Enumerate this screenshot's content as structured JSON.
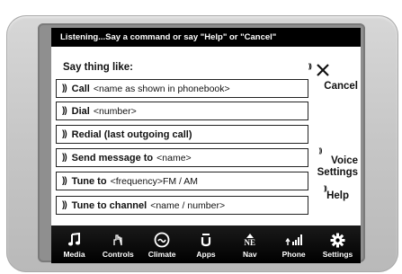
{
  "status_bar": {
    "text": "Listening...Say a command or say \"Help\" or \"Cancel\""
  },
  "prompt": "Say thing like:",
  "voice_glyph": "))",
  "commands": [
    {
      "label": "Call",
      "param": "<name as shown in phonebook>"
    },
    {
      "label": "Dial",
      "param": "<number>"
    },
    {
      "label": "Redial (last outgoing call)",
      "param": ""
    },
    {
      "label": "Send message to",
      "param": "<name>"
    },
    {
      "label": "Tune to",
      "param": "<frequency>FM / AM"
    },
    {
      "label": "Tune to channel",
      "param": "<name / number>"
    }
  ],
  "side_buttons": {
    "cancel": "Cancel",
    "voice_settings_line1": "Voice",
    "voice_settings_line2": "Settings",
    "help": "Help"
  },
  "dock": [
    {
      "label": "Media",
      "icon": "music-note-icon"
    },
    {
      "label": "Controls",
      "icon": "hand-controls-icon"
    },
    {
      "label": "Climate",
      "icon": "climate-icon"
    },
    {
      "label": "Apps",
      "icon": "apps-icon"
    },
    {
      "label": "Nav",
      "icon": "compass-icon",
      "compass": "NE"
    },
    {
      "label": "Phone",
      "icon": "phone-signal-icon"
    },
    {
      "label": "Settings",
      "icon": "gear-icon"
    }
  ],
  "colors": {
    "bezel": "#c9c9c9",
    "topbar": "#000000",
    "screen": "#ffffff",
    "dock": "#000000"
  }
}
